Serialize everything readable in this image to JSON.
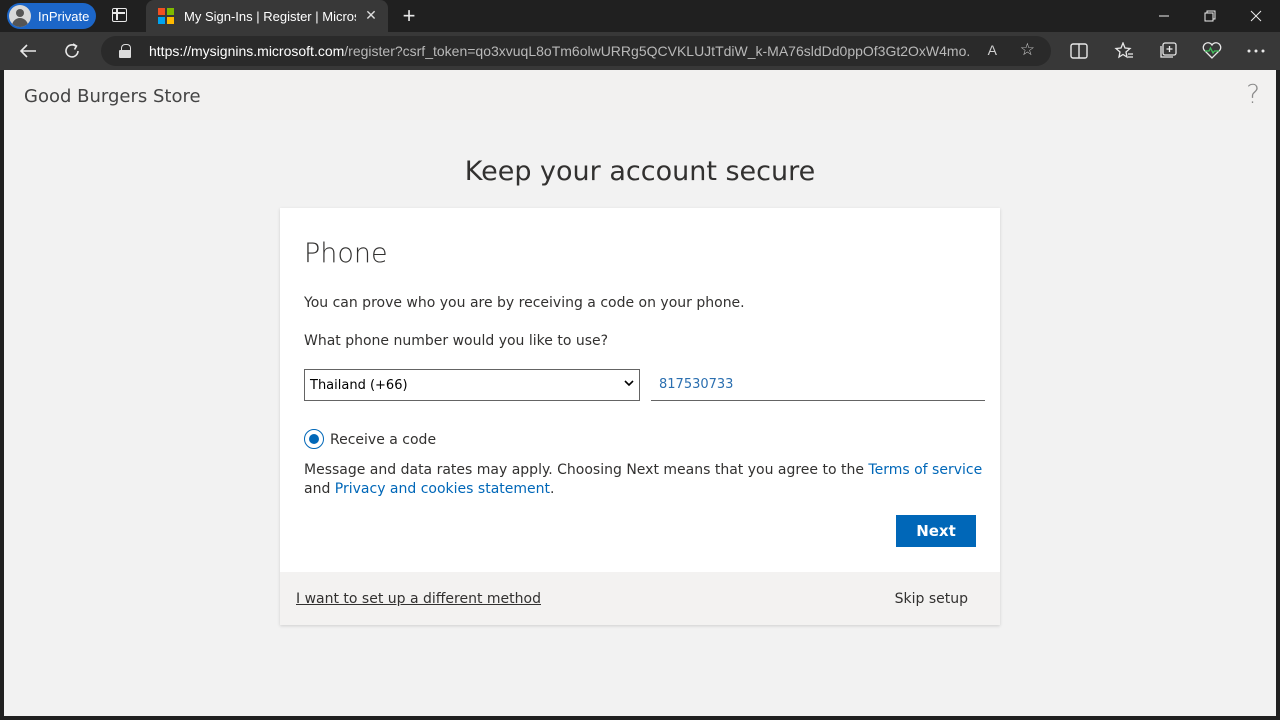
{
  "browser": {
    "profile_label": "InPrivate",
    "tab_title": "My Sign-Ins | Register | Microsoft",
    "tab_close": "✕",
    "new_tab": "+",
    "url_host": "https://mysignins.microsoft.com",
    "url_path": "/register?csrf_token=qo3xvuqL8oTm6olwURRg5QCVKLUJtTdiW_k-MA76sldDd0ppOf3Gt2OxW4mo...",
    "read_aloud": "A",
    "logo_colors": [
      "#f25022",
      "#7fba00",
      "#00a4ef",
      "#ffb900"
    ]
  },
  "header": {
    "org_name": "Good Burgers Store",
    "help": "?"
  },
  "main": {
    "title": "Keep your account secure"
  },
  "card": {
    "title": "Phone",
    "intro": "You can prove who you are by receiving a code on your phone.",
    "question": "What phone number would you like to use?",
    "country_value": "Thailand (+66)",
    "phone_value": "817530733",
    "radio_label": "Receive a code",
    "disclaimer_prefix": "Message and data rates may apply. Choosing Next means that you agree to the ",
    "terms_link": "Terms of service",
    "disclaimer_and": " and ",
    "privacy_link": "Privacy and cookies statement",
    "disclaimer_suffix": ".",
    "next_label": "Next"
  },
  "footer": {
    "different_method": "I want to set up a different method",
    "skip_setup": "Skip setup"
  },
  "colors": {
    "accent": "#0067b8",
    "link": "#0067b8",
    "page_bg": "#f2f2f2"
  }
}
